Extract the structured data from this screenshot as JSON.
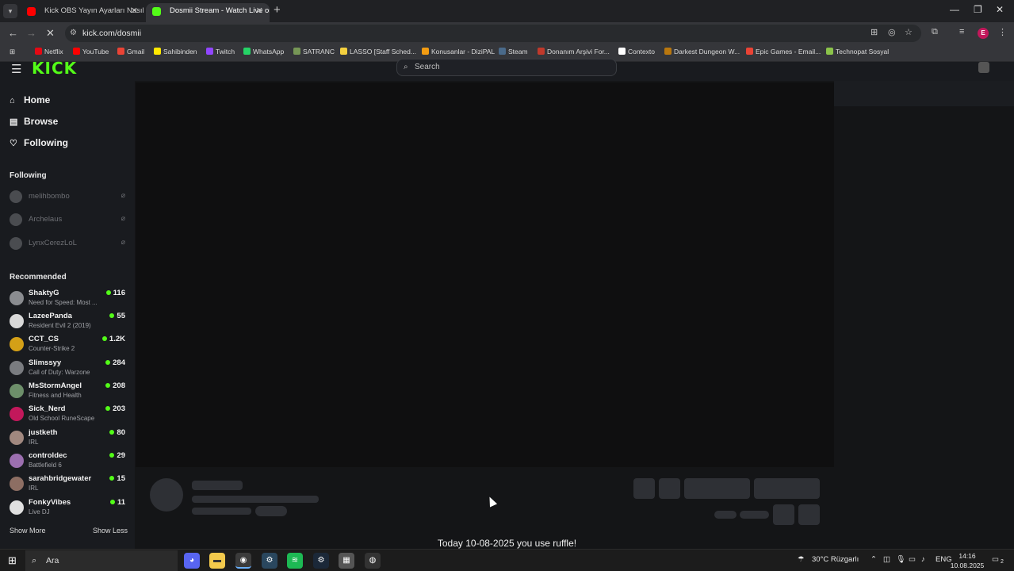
{
  "browser": {
    "tabs": [
      {
        "title": "Kick OBS Yayın Ayarları Nasıl Ya",
        "favicon_color": "#ff0000"
      },
      {
        "title": "Dosmii Stream - Watch Live on",
        "favicon_color": "#53fc18"
      }
    ],
    "url": "kick.com/dosmii",
    "profile_initial": "E",
    "bookmarks": [
      {
        "label": "Netflix",
        "color": "#e50914"
      },
      {
        "label": "YouTube",
        "color": "#ff0000"
      },
      {
        "label": "Gmail",
        "color": "#ea4335"
      },
      {
        "label": "Sahibinden",
        "color": "#ffe800"
      },
      {
        "label": "Twitch",
        "color": "#9146ff"
      },
      {
        "label": "WhatsApp",
        "color": "#25d366"
      },
      {
        "label": "SATRANC",
        "color": "#769656"
      },
      {
        "label": "LASSO [Staff Sched...",
        "color": "#f4d03f"
      },
      {
        "label": "Konusanlar - DiziPAL",
        "color": "#f39c12"
      },
      {
        "label": "Steam",
        "color": "#1b2838"
      },
      {
        "label": "Donanım Arşivi For...",
        "color": "#c0392b"
      },
      {
        "label": "Contexto",
        "color": "#ffffff"
      },
      {
        "label": "Darkest Dungeon W...",
        "color": "#b9770e"
      },
      {
        "label": "Epic Games - Email...",
        "color": "#ea4335"
      },
      {
        "label": "Technopat Sosyal",
        "color": "#8bc34a"
      }
    ]
  },
  "site": {
    "search_placeholder": "Search",
    "nav": [
      {
        "label": "Home",
        "icon": "home-icon"
      },
      {
        "label": "Browse",
        "icon": "browse-icon"
      },
      {
        "label": "Following",
        "icon": "heart-icon"
      }
    ],
    "following_title": "Following",
    "following": [
      "melihbombo",
      "Archelaus",
      "LynxCerezLoL"
    ],
    "recommended_title": "Recommended",
    "recommended": [
      {
        "name": "ShaktyG",
        "category": "Need for Speed: Most ...",
        "viewers": "116",
        "color": "#8a8c90"
      },
      {
        "name": "LazeePanda",
        "category": "Resident Evil 2 (2019)",
        "viewers": "55",
        "color": "#d9d9d9"
      },
      {
        "name": "CCT_CS",
        "category": "Counter-Strike 2",
        "viewers": "1.2K",
        "color": "#d4a017"
      },
      {
        "name": "Slimssyy",
        "category": "Call of Duty: Warzone",
        "viewers": "284",
        "color": "#7a7c80"
      },
      {
        "name": "MsStormAngel",
        "category": "Fitness and Health",
        "viewers": "208",
        "color": "#6d8f6a"
      },
      {
        "name": "Sick_Nerd",
        "category": "Old School RuneScape",
        "viewers": "203",
        "color": "#c2185b"
      },
      {
        "name": "justketh",
        "category": "IRL",
        "viewers": "80",
        "color": "#a1887f"
      },
      {
        "name": "controldec",
        "category": "Battlefield 6",
        "viewers": "29",
        "color": "#9c6fb0"
      },
      {
        "name": "sarahbridgewater",
        "category": "IRL",
        "viewers": "15",
        "color": "#8d6e63"
      },
      {
        "name": "FonkyVibes",
        "category": "Live DJ",
        "viewers": "11",
        "color": "#e0e0e0"
      }
    ],
    "show_more": "Show More",
    "show_less": "Show Less",
    "caption": "Today 10-08-2025 you use ruffle!"
  },
  "taskbar": {
    "search_placeholder": "Ara",
    "weather": "30°C Rüzgarlı",
    "language": "ENG",
    "time": "14:16",
    "date": "10.08.2025",
    "notification_count": "2"
  }
}
